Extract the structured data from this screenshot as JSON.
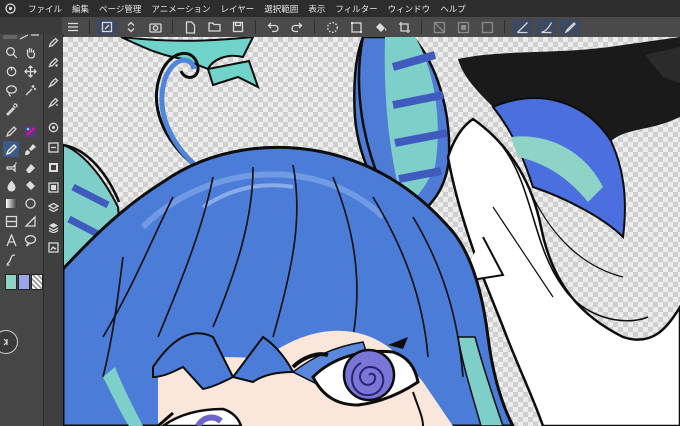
{
  "menubar": {
    "items": [
      "ファイル",
      "編集",
      "ページ管理",
      "アニメーション",
      "レイヤー",
      "選択範囲",
      "表示",
      "フィルター",
      "ウィンドウ",
      "ヘルプ"
    ]
  },
  "command_bar": {
    "icons": [
      "menu-icon",
      "brush-select-icon",
      "layer-property-icon",
      "camera-icon",
      "new-file-icon",
      "open-icon",
      "save-icon",
      "undo-icon",
      "redo-icon",
      "loading-icon",
      "transform-icon",
      "fill-icon",
      "crop-icon",
      "dim-icon-a",
      "dim-icon-b",
      "dim-icon-c",
      "ruler-icon",
      "brush-curve-icon",
      "pen-icon"
    ]
  },
  "colors": {
    "main": "#8fd3c6",
    "sub": "#9aa6e8",
    "accent": "#3a5a8c"
  }
}
